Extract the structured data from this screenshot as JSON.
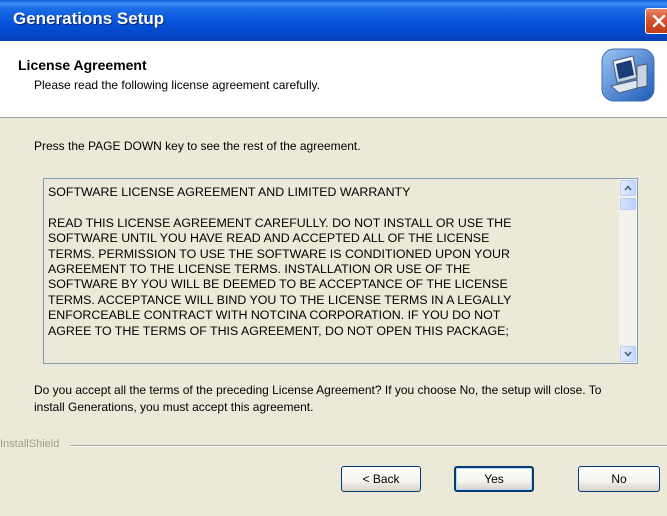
{
  "window": {
    "title": "Generations Setup"
  },
  "header": {
    "title": "License Agreement",
    "subtitle": "Please read the following license agreement carefully.",
    "icon": "computer-setup-icon"
  },
  "instruction": "Press the PAGE DOWN key to see the rest of the agreement.",
  "license": {
    "text": "SOFTWARE LICENSE AGREEMENT AND LIMITED WARRANTY\n\nREAD THIS LICENSE AGREEMENT CAREFULLY.  DO NOT INSTALL OR USE THE\nSOFTWARE UNTIL YOU HAVE READ AND ACCEPTED ALL OF THE LICENSE\nTERMS.  PERMISSION TO USE THE SOFTWARE IS CONDITIONED UPON YOUR\nAGREEMENT TO THE LICENSE TERMS.  INSTALLATION OR USE OF THE\nSOFTWARE BY YOU WILL BE DEEMED TO BE ACCEPTANCE OF THE LICENSE\nTERMS.  ACCEPTANCE WILL BIND YOU TO THE LICENSE TERMS IN A LEGALLY\nENFORCEABLE CONTRACT WITH NOTCINA CORPORATION.  IF YOU DO NOT\nAGREE TO THE TERMS OF THIS AGREEMENT, DO NOT OPEN THIS PACKAGE;"
  },
  "question": "Do you accept all the terms of the preceding License Agreement?  If you choose No,  the setup will close.  To install Generations, you must accept this agreement.",
  "brand": "InstallShield",
  "buttons": {
    "back": "< Back",
    "yes": "Yes",
    "no": "No"
  },
  "colors": {
    "titlebar": "#0551d8",
    "dialog_bg": "#ECE9D8",
    "close": "#d9532f",
    "button_border": "#003c74"
  }
}
